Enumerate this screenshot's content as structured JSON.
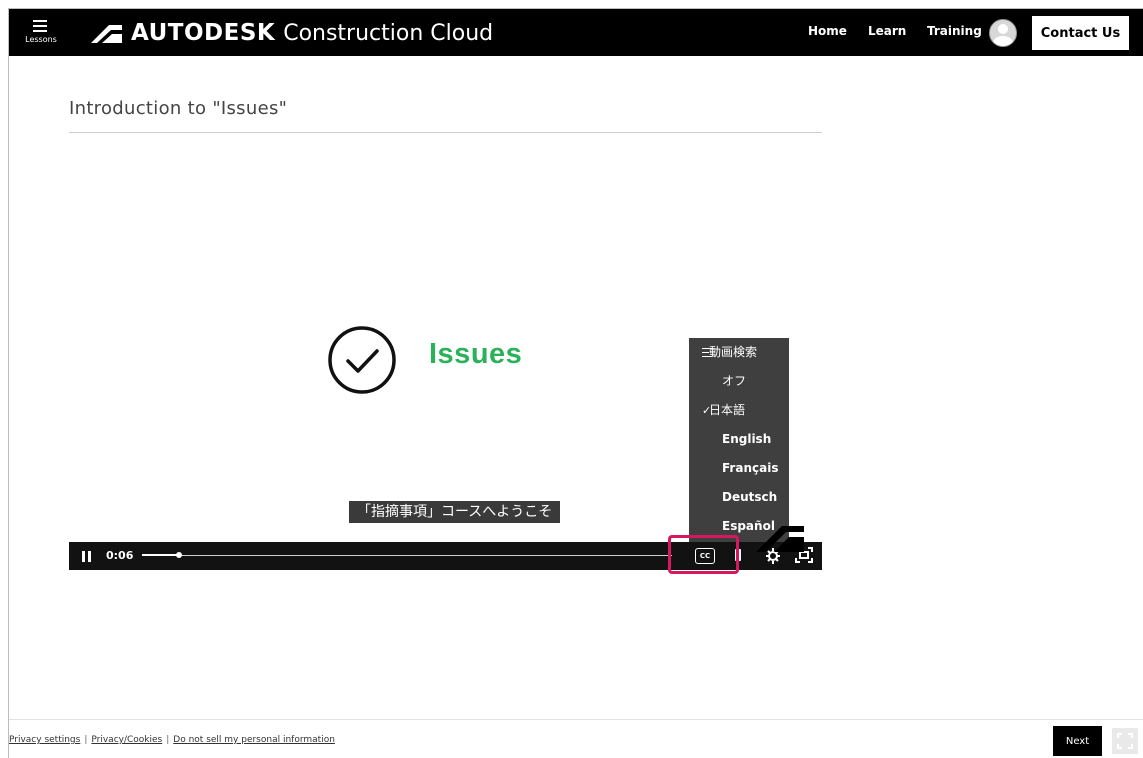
{
  "header": {
    "lessons_label": "Lessons",
    "brand": "AUTODESK",
    "product": "Construction Cloud",
    "nav": [
      "Home",
      "Learn",
      "Training"
    ],
    "contact_label": "Contact Us",
    "background_color": "#000000"
  },
  "page": {
    "title": "Introduction to \"Issues\""
  },
  "video": {
    "slide_title": "Issues",
    "slide_title_color": "#2cb15b",
    "caption": "「指摘事項」コースへようこそ",
    "time": "0:06",
    "progress": 0.07,
    "icons": [
      "pause-icon",
      "closed-captions-icon",
      "volume-icon",
      "settings-gear-icon",
      "fullscreen-icon"
    ],
    "cc_label": "CC",
    "cc_highlight_color": "#d6185f"
  },
  "cc_menu": {
    "search_label": "動画検索",
    "options": [
      {
        "label": "オフ",
        "selected": false
      },
      {
        "label": "日本語",
        "selected": true
      },
      {
        "label": "English",
        "selected": false
      },
      {
        "label": "Français",
        "selected": false
      },
      {
        "label": "Deutsch",
        "selected": false
      },
      {
        "label": "Español",
        "selected": false
      }
    ],
    "check_mark": "✓"
  },
  "footer": {
    "links": [
      "Privacy settings",
      "Privacy/Cookies",
      "Do not sell my personal information"
    ],
    "separator": "|",
    "next_label": "Next"
  }
}
